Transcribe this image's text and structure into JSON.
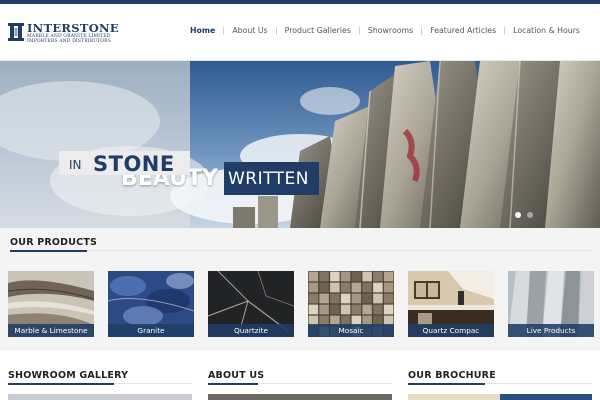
{
  "brand": {
    "name": "INTERSTONE",
    "tagline_1": "MARBLE AND GRANITE LIMITED",
    "tagline_2": "IMPORTERS AND DISTRIBUTORS",
    "logo_icon": "pillar-logo-icon"
  },
  "nav": {
    "items": [
      {
        "label": "Home",
        "active": true
      },
      {
        "label": "About Us",
        "active": false
      },
      {
        "label": "Product Galleries",
        "active": false
      },
      {
        "label": "Showrooms",
        "active": false
      },
      {
        "label": "Featured Articles",
        "active": false
      },
      {
        "label": "Location & Hours",
        "active": false
      }
    ]
  },
  "hero": {
    "caption_line1_bold": "BEAUTY",
    "caption_line1_box": "WRITTEN",
    "caption_line2_small": "IN",
    "caption_line2_big": "STONE",
    "slide_count": 2,
    "active_slide": 1
  },
  "products": {
    "title": "OUR PRODUCTS",
    "items": [
      {
        "label": "Marble & Limestone"
      },
      {
        "label": "Granite"
      },
      {
        "label": "Quartzite"
      },
      {
        "label": "Mosaic"
      },
      {
        "label": "Quartz Compac"
      },
      {
        "label": "Live Products"
      }
    ]
  },
  "sections": {
    "showroom_gallery": "SHOWROOM GALLERY",
    "about_us": "ABOUT US",
    "our_brochure": "OUR BROCHURE"
  },
  "colors": {
    "brand_navy": "#1f3d66",
    "nav_text": "#555555",
    "section_bg": "#f4f4f4"
  }
}
